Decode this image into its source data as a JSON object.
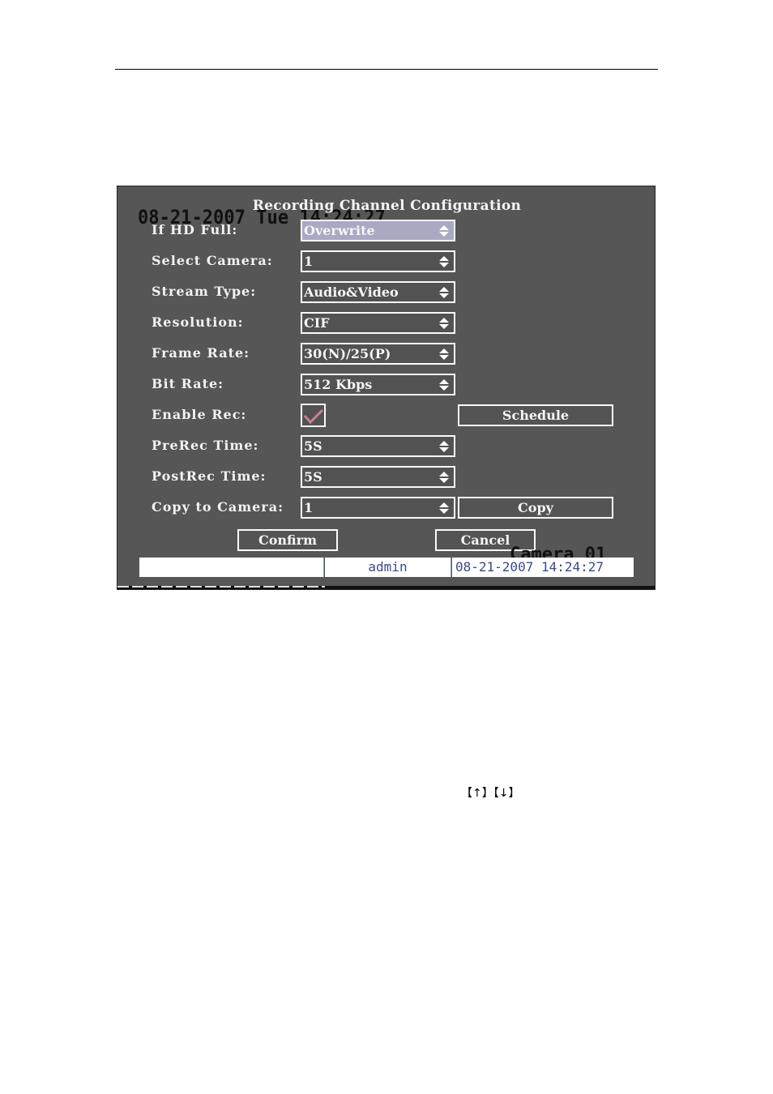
{
  "osd": {
    "date_overlay": "08-21-2007 Tue 14:24:27",
    "camera_label": "Camera 01"
  },
  "dialog": {
    "title": "Recording Channel Configuration",
    "fields": [
      {
        "label": "If HD Full:",
        "value": "Overwrite",
        "focused": true
      },
      {
        "label": "Select Camera:",
        "value": "1"
      },
      {
        "label": "Stream Type:",
        "value": "Audio&Video"
      },
      {
        "label": "Resolution:",
        "value": "CIF"
      },
      {
        "label": "Frame Rate:",
        "value": "30(N)/25(P)"
      },
      {
        "label": "Bit Rate:",
        "value": "512 Kbps"
      }
    ],
    "enable_rec": {
      "label": "Enable Rec:",
      "checked": true,
      "check_color": "#c9808a"
    },
    "schedule_button": "Schedule",
    "prerec": {
      "label": "PreRec Time:",
      "value": "5S"
    },
    "postrec": {
      "label": "PostRec Time:",
      "value": "5S"
    },
    "copy_to_camera": {
      "label": "Copy to Camera:",
      "value": "1"
    },
    "copy_button": "Copy",
    "confirm_button": "Confirm",
    "cancel_button": "Cancel"
  },
  "status_bar": {
    "message": "",
    "user": "admin",
    "datetime": "08-21-2007 14:24:27"
  },
  "document": {
    "key_hint": "【↑】【↓】"
  },
  "icons": {
    "spinner": "up-down-arrows",
    "check": "checkmark"
  }
}
